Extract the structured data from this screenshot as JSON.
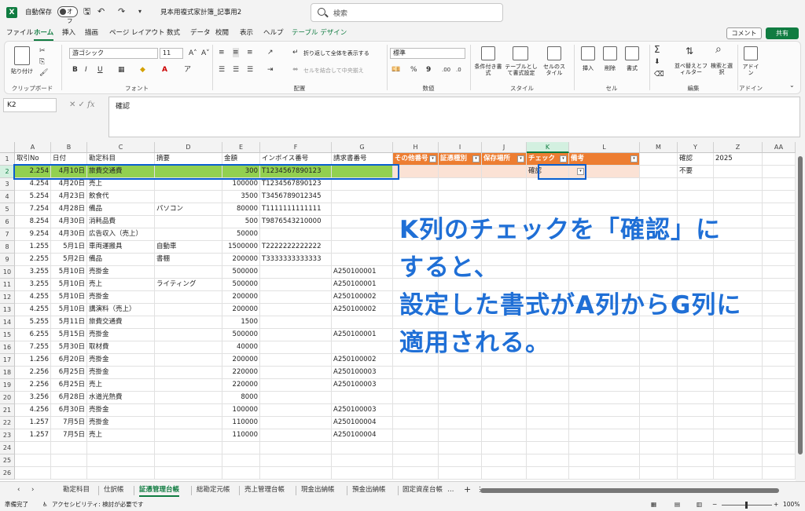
{
  "titlebar": {
    "autosave_label": "自動保存",
    "toggle_label": "オフ",
    "doc_title": "見本用複式家計簿_記事用2",
    "search_placeholder": "検索"
  },
  "menu": {
    "tabs": [
      "ファイル",
      "ホーム",
      "挿入",
      "描画",
      "ページ レイアウト",
      "数式",
      "データ",
      "校閲",
      "表示",
      "ヘルプ",
      "テーブル デザイン"
    ],
    "comment_label": "コメント",
    "share_label": "共有"
  },
  "ribbon": {
    "clipboard": {
      "paste_label": "貼り付け",
      "group": "クリップボード"
    },
    "font": {
      "name": "游ゴシック",
      "size": "11",
      "group": "フォント"
    },
    "align": {
      "wrap_label": "折り返して全体を表示する",
      "merge_label": "セルを結合して中央揃え",
      "group": "配置"
    },
    "number": {
      "format": "標準",
      "group": "数値"
    },
    "styles": {
      "cond_label": "条件付き書式",
      "table_label": "テーブルとして書式設定",
      "cell_label": "セルのスタイル",
      "group": "スタイル"
    },
    "cells": {
      "insert_label": "挿入",
      "delete_label": "削除",
      "format_label": "書式",
      "group": "セル"
    },
    "edit": {
      "sort_label": "並べ替えとフィルター",
      "find_label": "検索と選択",
      "group": "編集"
    },
    "addin": {
      "label": "アドイン",
      "group": "アドイン"
    }
  },
  "formula": {
    "namebox": "K2",
    "value": "確認"
  },
  "grid": {
    "columns": [
      {
        "letter": "A",
        "w": 46
      },
      {
        "letter": "B",
        "w": 46
      },
      {
        "letter": "C",
        "w": 86
      },
      {
        "letter": "D",
        "w": 86
      },
      {
        "letter": "E",
        "w": 48
      },
      {
        "letter": "F",
        "w": 91
      },
      {
        "letter": "G",
        "w": 78
      },
      {
        "letter": "H",
        "w": 58
      },
      {
        "letter": "I",
        "w": 55
      },
      {
        "letter": "J",
        "w": 57
      },
      {
        "letter": "K",
        "w": 54
      },
      {
        "letter": "L",
        "w": 90
      },
      {
        "letter": "M",
        "w": 48
      },
      {
        "letter": "Y",
        "w": 46
      },
      {
        "letter": "Z",
        "w": 62
      },
      {
        "letter": "AA",
        "w": 42
      }
    ],
    "headers": [
      "取引No",
      "日付",
      "勘定科目",
      "摘要",
      "金額",
      "インボイス番号",
      "請求書番号",
      "その他番号",
      "証憑種別",
      "保存場所",
      "チェック",
      "備考",
      "",
      "確認",
      "2025",
      ""
    ],
    "rows": [
      [
        "2.254",
        "4月10日",
        "旅費交通費",
        "",
        "300",
        "T1234567890123",
        "",
        "",
        "",
        "",
        "確認",
        "",
        "",
        "不要",
        "",
        ""
      ],
      [
        "4.254",
        "4月20日",
        "売上",
        "",
        "100000",
        "T1234567890123",
        "",
        "",
        "",
        "",
        "",
        "",
        "",
        "",
        "",
        ""
      ],
      [
        "5.254",
        "4月23日",
        "飲食代",
        "",
        "3500",
        "T3456789012345",
        "",
        "",
        "",
        "",
        "",
        "",
        "",
        "",
        "",
        ""
      ],
      [
        "7.254",
        "4月28日",
        "備品",
        "パソコン",
        "80000",
        "T1111111111111",
        "",
        "",
        "",
        "",
        "",
        "",
        "",
        "",
        "",
        ""
      ],
      [
        "8.254",
        "4月30日",
        "消耗品費",
        "",
        "500",
        "T9876543210000",
        "",
        "",
        "",
        "",
        "",
        "",
        "",
        "",
        "",
        ""
      ],
      [
        "9.254",
        "4月30日",
        "広告収入（売上）",
        "",
        "50000",
        "",
        "",
        "",
        "",
        "",
        "",
        "",
        "",
        "",
        "",
        ""
      ],
      [
        "1.255",
        "5月1日",
        "車両運搬具",
        "自動車",
        "1500000",
        "T2222222222222",
        "",
        "",
        "",
        "",
        "",
        "",
        "",
        "",
        "",
        ""
      ],
      [
        "2.255",
        "5月2日",
        "備品",
        "書棚",
        "200000",
        "T3333333333333",
        "",
        "",
        "",
        "",
        "",
        "",
        "",
        "",
        "",
        ""
      ],
      [
        "3.255",
        "5月10日",
        "売掛金",
        "",
        "500000",
        "",
        "A250100001",
        "",
        "",
        "",
        "",
        "",
        "",
        "",
        "",
        ""
      ],
      [
        "3.255",
        "5月10日",
        "売上",
        "ライティング",
        "500000",
        "",
        "A250100001",
        "",
        "",
        "",
        "",
        "",
        "",
        "",
        "",
        ""
      ],
      [
        "4.255",
        "5月10日",
        "売掛金",
        "",
        "200000",
        "",
        "A250100002",
        "",
        "",
        "",
        "",
        "",
        "",
        "",
        "",
        ""
      ],
      [
        "4.255",
        "5月10日",
        "講演料（売上）",
        "",
        "200000",
        "",
        "A250100002",
        "",
        "",
        "",
        "",
        "",
        "",
        "",
        "",
        ""
      ],
      [
        "5.255",
        "5月11日",
        "旅費交通費",
        "",
        "1500",
        "",
        "",
        "",
        "",
        "",
        "",
        "",
        "",
        "",
        "",
        ""
      ],
      [
        "6.255",
        "5月15日",
        "売掛金",
        "",
        "500000",
        "",
        "A250100001",
        "",
        "",
        "",
        "",
        "",
        "",
        "",
        "",
        ""
      ],
      [
        "7.255",
        "5月30日",
        "取材費",
        "",
        "40000",
        "",
        "",
        "",
        "",
        "",
        "",
        "",
        "",
        "",
        "",
        ""
      ],
      [
        "1.256",
        "6月20日",
        "売掛金",
        "",
        "200000",
        "",
        "A250100002",
        "",
        "",
        "",
        "",
        "",
        "",
        "",
        "",
        ""
      ],
      [
        "2.256",
        "6月25日",
        "売掛金",
        "",
        "220000",
        "",
        "A250100003",
        "",
        "",
        "",
        "",
        "",
        "",
        "",
        "",
        ""
      ],
      [
        "2.256",
        "6月25日",
        "売上",
        "",
        "220000",
        "",
        "A250100003",
        "",
        "",
        "",
        "",
        "",
        "",
        "",
        "",
        ""
      ],
      [
        "3.256",
        "6月28日",
        "水道光熱費",
        "",
        "8000",
        "",
        "",
        "",
        "",
        "",
        "",
        "",
        "",
        "",
        "",
        ""
      ],
      [
        "4.256",
        "6月30日",
        "売掛金",
        "",
        "100000",
        "",
        "A250100003",
        "",
        "",
        "",
        "",
        "",
        "",
        "",
        "",
        ""
      ],
      [
        "1.257",
        "7月5日",
        "売掛金",
        "",
        "110000",
        "",
        "A250100004",
        "",
        "",
        "",
        "",
        "",
        "",
        "",
        "",
        ""
      ],
      [
        "1.257",
        "7月5日",
        "売上",
        "",
        "110000",
        "",
        "A250100004",
        "",
        "",
        "",
        "",
        "",
        "",
        "",
        "",
        ""
      ],
      [
        "",
        "",
        "",
        "",
        "",
        "",
        "",
        "",
        "",
        "",
        "",
        "",
        "",
        "",
        "",
        ""
      ],
      [
        "",
        "",
        "",
        "",
        "",
        "",
        "",
        "",
        "",
        "",
        "",
        "",
        "",
        "",
        "",
        ""
      ],
      [
        "",
        "",
        "",
        "",
        "",
        "",
        "",
        "",
        "",
        "",
        "",
        "",
        "",
        "",
        "",
        ""
      ]
    ]
  },
  "note": {
    "lines": [
      "K列のチェックを「確認」に",
      "すると、",
      "設定した書式がA列からG列に",
      "適用される。"
    ]
  },
  "sheets": {
    "tabs": [
      "勘定科目",
      "仕訳帳",
      "証憑管理台帳",
      "総勘定元帳",
      "売上管理台帳",
      "現金出納帳",
      "預金出納帳",
      "固定資産台帳"
    ],
    "active": 2
  },
  "status": {
    "ready": "準備完了",
    "accessibility": "アクセシビリティ: 検討が必要です",
    "zoom": "100%"
  },
  "colors": {
    "excel_green": "#107c41",
    "table_orange": "#ed7d31",
    "highlight_green": "#92d050",
    "annotation_blue": "#1f6fd6"
  }
}
